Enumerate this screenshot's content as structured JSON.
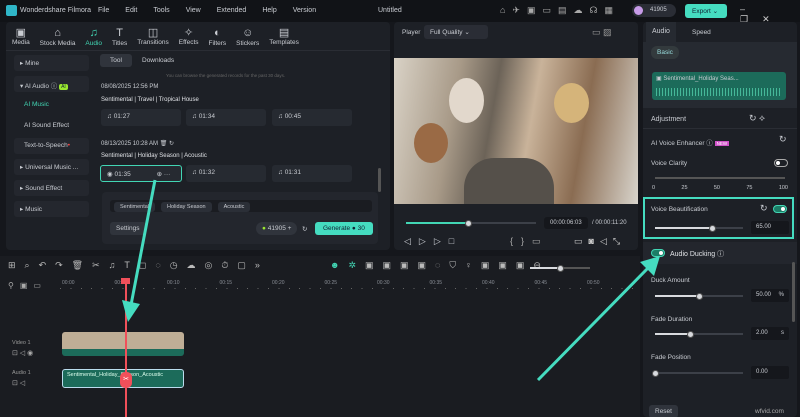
{
  "app": {
    "title": "Wonderdshare Filmora",
    "project": "Untitled",
    "menu": [
      "File",
      "Edit",
      "Tools",
      "View",
      "Extended",
      "Help",
      "Version"
    ],
    "credits": "41905",
    "export_label": "Export"
  },
  "toolbar": [
    "Media",
    "Stock Media",
    "Audio",
    "Titles",
    "Transitions",
    "Effects",
    "Filters",
    "Stickers",
    "Templates"
  ],
  "sidebar": {
    "items": [
      {
        "label": "Mine"
      },
      {
        "label": "AI Audio",
        "badge": "AI"
      },
      {
        "label": "AI Music"
      },
      {
        "label": "AI Sound Effect"
      },
      {
        "label": "Text-to-Speech"
      },
      {
        "label": "Universal Music ..."
      },
      {
        "label": "Sound Effect"
      },
      {
        "label": "Music"
      }
    ]
  },
  "music": {
    "tabs": [
      "Tool",
      "Downloads"
    ],
    "notice": "You can browse the generated records for the past 30 days.",
    "groups": [
      {
        "date": "08/08/2025 12:56 PM",
        "tags": "Sentimental | Travel | Tropical House",
        "tracks": [
          "01:27",
          "01:34",
          "00:45"
        ]
      },
      {
        "date": "08/13/2025 10:28 AM",
        "tags": "Sentimental | Holiday Season | Acoustic",
        "tracks": [
          "01:35",
          "01:32",
          "01:31"
        ]
      }
    ],
    "chips": [
      "Sentimental",
      "Holiday Season",
      "Acoustic"
    ],
    "settings_label": "Settings",
    "credits": "41905",
    "generate_label": "Generate",
    "generate_cost": "30"
  },
  "player": {
    "label": "Player",
    "quality": "Full Quality",
    "current": "00:00:06:03",
    "total": "/ 00:00:11:20",
    "progress": 0.48
  },
  "right": {
    "tabs": [
      "Audio",
      "Speed"
    ],
    "basic": "Basic",
    "clip_name": "Sentimental_Holiday Seas...",
    "adjustment": "Adjustment",
    "enhancer": "AI Voice Enhancer",
    "new_badge": "NEW",
    "clarity": {
      "label": "Voice Clarity",
      "ticks": [
        "0",
        "25",
        "50",
        "75",
        "100"
      ]
    },
    "beautification": {
      "label": "Voice Beautification",
      "value": "65.00",
      "fraction": 0.65
    },
    "ducking": {
      "label": "Audio Ducking"
    },
    "duck_amount": {
      "label": "Duck Amount",
      "value": "50.00",
      "unit": "%",
      "fraction": 0.5
    },
    "fade_duration": {
      "label": "Fade Duration",
      "value": "2.00",
      "unit": "s",
      "fraction": 0.4
    },
    "fade_position": {
      "label": "Fade Position",
      "value": "0.00",
      "fraction": 0
    },
    "reset": "Reset"
  },
  "timeline": {
    "ruler": [
      "00:00",
      "00:05",
      "00:10",
      "00:15",
      "00:20",
      "00:25",
      "00:30",
      "00:35",
      "00:40",
      "00:45",
      "00:50"
    ],
    "tracks": [
      {
        "label": "Video 1"
      },
      {
        "label": "Audio 1",
        "clip": "Sentimental_Holiday_Season_Acoustic"
      }
    ]
  },
  "watermark": "wfvid.com",
  "colors": {
    "accent": "#42d6b4",
    "playhead": "#f0505a"
  }
}
